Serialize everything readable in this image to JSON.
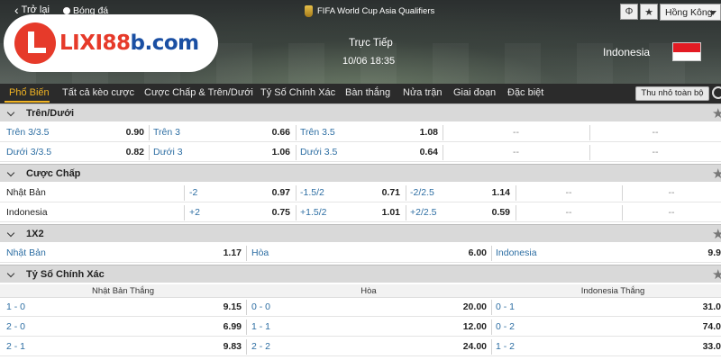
{
  "header": {
    "back_label": "Trở lại",
    "sport_label": "Bóng đá",
    "competition": "FIFA World Cup Asia Qualifiers",
    "status": "Trực Tiếp",
    "datetime": "10/06 18:35",
    "away_team": "Indonesia",
    "language": "Hồng Kông",
    "brand_main": "LIXI88",
    "brand_domain": "b.com"
  },
  "tabs": [
    {
      "label": "Phổ Biến",
      "active": true
    },
    {
      "label": "Tất cả kèo cược",
      "active": false
    },
    {
      "label": "Cược Chấp & Trên/Dưới",
      "active": false
    },
    {
      "label": "Tỷ Số Chính Xác",
      "active": false
    },
    {
      "label": "Bàn thắng",
      "active": false
    },
    {
      "label": "Nửa trận",
      "active": false
    },
    {
      "label": "Giai đoạn",
      "active": false
    },
    {
      "label": "Đặc biệt",
      "active": false
    }
  ],
  "collapse_all": "Thu nhỏ toàn bộ",
  "over_under": {
    "title": "Trên/Dưới",
    "rows": [
      [
        {
          "label": "Trên 3/3.5",
          "odd": "0.90"
        },
        {
          "label": "Trên 3",
          "odd": "0.66"
        },
        {
          "label": "Trên 3.5",
          "odd": "1.08"
        },
        {
          "label": "--"
        },
        {
          "label": "--"
        }
      ],
      [
        {
          "label": "Dưới 3/3.5",
          "odd": "0.82"
        },
        {
          "label": "Dưới 3",
          "odd": "1.06"
        },
        {
          "label": "Dưới 3.5",
          "odd": "0.64"
        },
        {
          "label": "--"
        },
        {
          "label": "--"
        }
      ]
    ]
  },
  "handicap": {
    "title": "Cược Chấp",
    "rows": [
      {
        "team": "Nhật Bản",
        "lines": [
          {
            "line": "-2",
            "odd": "0.97"
          },
          {
            "line": "-1.5/2",
            "odd": "0.71"
          },
          {
            "line": "-2/2.5",
            "odd": "1.14"
          }
        ],
        "dashes": [
          "--",
          "--"
        ]
      },
      {
        "team": "Indonesia",
        "lines": [
          {
            "line": "+2",
            "odd": "0.75"
          },
          {
            "line": "+1.5/2",
            "odd": "1.01"
          },
          {
            "line": "+2/2.5",
            "odd": "0.59"
          }
        ],
        "dashes": [
          "--",
          "--"
        ]
      }
    ]
  },
  "one_x_two": {
    "title": "1X2",
    "cells": [
      {
        "label": "Nhật Bản",
        "odd": "1.17"
      },
      {
        "label": "Hòa",
        "odd": "6.00"
      },
      {
        "label": "Indonesia",
        "odd": "9.9"
      }
    ]
  },
  "correct_score": {
    "title": "Tỷ Số Chính Xác",
    "columns": [
      "Nhật Bản Thắng",
      "Hòa",
      "Indonesia Thắng"
    ],
    "rows": [
      [
        {
          "score": "1 - 0",
          "odd": "9.15"
        },
        {
          "score": "0 - 0",
          "odd": "20.00"
        },
        {
          "score": "0 - 1",
          "odd": "31.0"
        }
      ],
      [
        {
          "score": "2 - 0",
          "odd": "6.99"
        },
        {
          "score": "1 - 1",
          "odd": "12.00"
        },
        {
          "score": "0 - 2",
          "odd": "74.0"
        }
      ],
      [
        {
          "score": "2 - 1",
          "odd": "9.83"
        },
        {
          "score": "2 - 2",
          "odd": "24.00"
        },
        {
          "score": "1 - 2",
          "odd": "33.0"
        }
      ]
    ]
  },
  "colors": {
    "accent": "#f0b323",
    "link": "#2d6ea3",
    "brand_red": "#e63a2a",
    "brand_blue": "#1a4fa3"
  }
}
